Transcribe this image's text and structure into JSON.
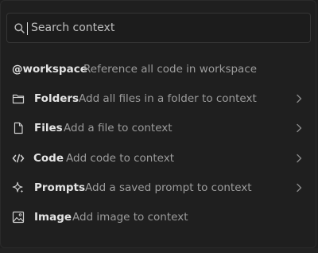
{
  "search": {
    "placeholder": "Search context",
    "value": ""
  },
  "items": [
    {
      "id": "workspace",
      "icon": "at-icon",
      "name": "@workspace",
      "description": "Reference all code in workspace",
      "has_submenu": false
    },
    {
      "id": "folders",
      "icon": "folder-icon",
      "name": "Folders",
      "description": "Add all files in a folder to context",
      "has_submenu": true
    },
    {
      "id": "files",
      "icon": "file-icon",
      "name": "Files",
      "description": "Add a file to context",
      "has_submenu": true
    },
    {
      "id": "code",
      "icon": "code-icon",
      "name": "Code",
      "description": "Add code to context",
      "has_submenu": true
    },
    {
      "id": "prompts",
      "icon": "sparkle-icon",
      "name": "Prompts",
      "description": "Add a saved prompt to context",
      "has_submenu": true
    },
    {
      "id": "image",
      "icon": "image-icon",
      "name": "Image",
      "description": "Add image to context",
      "has_submenu": false
    }
  ],
  "colors": {
    "background": "#1f1f1f",
    "border": "#353535",
    "name_text": "#e3e3e3",
    "description_text": "#9c9c9c",
    "icon": "#cfcfcf",
    "chevron": "#8a8a8a"
  }
}
